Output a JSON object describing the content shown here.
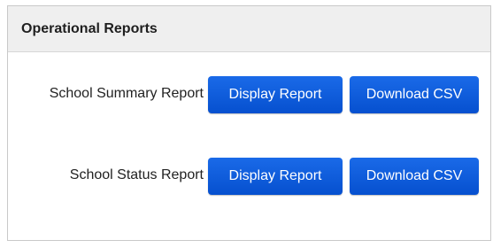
{
  "panel": {
    "title": "Operational Reports"
  },
  "reports": [
    {
      "label": "School Summary Report",
      "display_button": "Display Report",
      "download_button": "Download CSV"
    },
    {
      "label": "School Status Report",
      "display_button": "Display Report",
      "download_button": "Download CSV"
    }
  ],
  "colors": {
    "button_blue": "#0a57d9",
    "header_bg": "#efefef",
    "border": "#c9c9c9"
  }
}
